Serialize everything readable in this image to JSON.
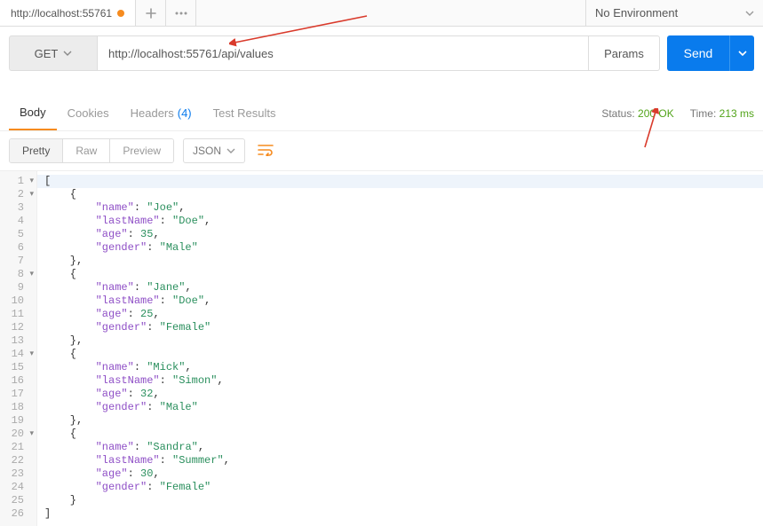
{
  "tab": {
    "title": "http://localhost:55761"
  },
  "env": {
    "label": "No Environment"
  },
  "request": {
    "method": "GET",
    "url": "http://localhost:55761/api/values",
    "params_label": "Params",
    "send_label": "Send"
  },
  "response_tabs": {
    "body": "Body",
    "cookies": "Cookies",
    "headers": "Headers",
    "headers_count": "(4)",
    "tests": "Test Results"
  },
  "status": {
    "label": "Status:",
    "value": "200 OK"
  },
  "time": {
    "label": "Time:",
    "value": "213 ms"
  },
  "view": {
    "pretty": "Pretty",
    "raw": "Raw",
    "preview": "Preview",
    "format": "JSON"
  },
  "body_lines": [
    {
      "n": 1,
      "fold": true,
      "indent": 0,
      "text": "["
    },
    {
      "n": 2,
      "fold": true,
      "indent": 1,
      "text": "{"
    },
    {
      "n": 3,
      "fold": false,
      "indent": 2,
      "kv": {
        "k": "name",
        "v": "Joe",
        "t": "s"
      },
      "comma": true
    },
    {
      "n": 4,
      "fold": false,
      "indent": 2,
      "kv": {
        "k": "lastName",
        "v": "Doe",
        "t": "s"
      },
      "comma": true
    },
    {
      "n": 5,
      "fold": false,
      "indent": 2,
      "kv": {
        "k": "age",
        "v": "35",
        "t": "n"
      },
      "comma": true
    },
    {
      "n": 6,
      "fold": false,
      "indent": 2,
      "kv": {
        "k": "gender",
        "v": "Male",
        "t": "s"
      },
      "comma": false
    },
    {
      "n": 7,
      "fold": false,
      "indent": 1,
      "text": "},"
    },
    {
      "n": 8,
      "fold": true,
      "indent": 1,
      "text": "{"
    },
    {
      "n": 9,
      "fold": false,
      "indent": 2,
      "kv": {
        "k": "name",
        "v": "Jane",
        "t": "s"
      },
      "comma": true
    },
    {
      "n": 10,
      "fold": false,
      "indent": 2,
      "kv": {
        "k": "lastName",
        "v": "Doe",
        "t": "s"
      },
      "comma": true
    },
    {
      "n": 11,
      "fold": false,
      "indent": 2,
      "kv": {
        "k": "age",
        "v": "25",
        "t": "n"
      },
      "comma": true
    },
    {
      "n": 12,
      "fold": false,
      "indent": 2,
      "kv": {
        "k": "gender",
        "v": "Female",
        "t": "s"
      },
      "comma": false
    },
    {
      "n": 13,
      "fold": false,
      "indent": 1,
      "text": "},"
    },
    {
      "n": 14,
      "fold": true,
      "indent": 1,
      "text": "{"
    },
    {
      "n": 15,
      "fold": false,
      "indent": 2,
      "kv": {
        "k": "name",
        "v": "Mick",
        "t": "s"
      },
      "comma": true
    },
    {
      "n": 16,
      "fold": false,
      "indent": 2,
      "kv": {
        "k": "lastName",
        "v": "Simon",
        "t": "s"
      },
      "comma": true
    },
    {
      "n": 17,
      "fold": false,
      "indent": 2,
      "kv": {
        "k": "age",
        "v": "32",
        "t": "n"
      },
      "comma": true
    },
    {
      "n": 18,
      "fold": false,
      "indent": 2,
      "kv": {
        "k": "gender",
        "v": "Male",
        "t": "s"
      },
      "comma": false
    },
    {
      "n": 19,
      "fold": false,
      "indent": 1,
      "text": "},"
    },
    {
      "n": 20,
      "fold": true,
      "indent": 1,
      "text": "{"
    },
    {
      "n": 21,
      "fold": false,
      "indent": 2,
      "kv": {
        "k": "name",
        "v": "Sandra",
        "t": "s"
      },
      "comma": true
    },
    {
      "n": 22,
      "fold": false,
      "indent": 2,
      "kv": {
        "k": "lastName",
        "v": "Summer",
        "t": "s"
      },
      "comma": true
    },
    {
      "n": 23,
      "fold": false,
      "indent": 2,
      "kv": {
        "k": "age",
        "v": "30",
        "t": "n"
      },
      "comma": true
    },
    {
      "n": 24,
      "fold": false,
      "indent": 2,
      "kv": {
        "k": "gender",
        "v": "Female",
        "t": "s"
      },
      "comma": false
    },
    {
      "n": 25,
      "fold": false,
      "indent": 1,
      "text": "}"
    },
    {
      "n": 26,
      "fold": false,
      "indent": 0,
      "text": "]"
    }
  ]
}
